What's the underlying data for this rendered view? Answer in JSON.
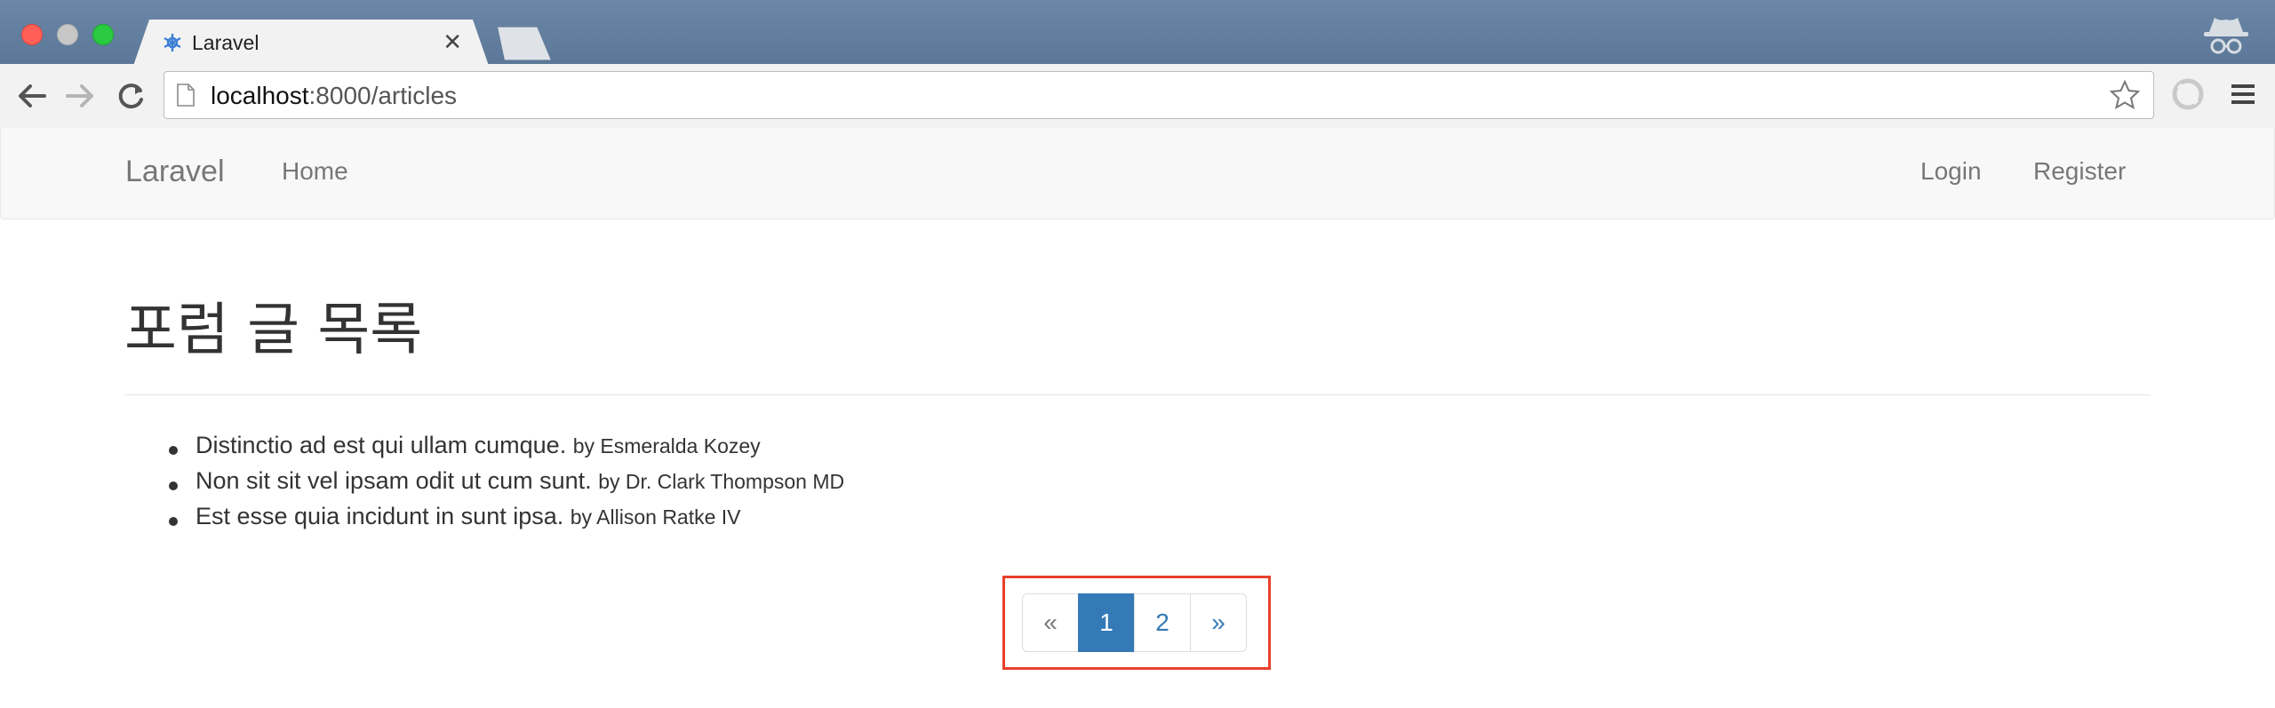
{
  "browser": {
    "tab_title": "Laravel",
    "close_glyph": "✕",
    "url_host": "localhost",
    "url_rest": ":8000/articles"
  },
  "navbar": {
    "brand": "Laravel",
    "home": "Home",
    "login": "Login",
    "register": "Register"
  },
  "page": {
    "heading": "포럼 글 목록",
    "articles": [
      {
        "title": "Distinctio ad est qui ullam cumque.",
        "author": "by Esmeralda Kozey"
      },
      {
        "title": "Non sit sit vel ipsam odit ut cum sunt.",
        "author": "by Dr. Clark Thompson MD"
      },
      {
        "title": "Est esse quia incidunt in sunt ipsa.",
        "author": "by Allison Ratke IV"
      }
    ]
  },
  "pagination": {
    "prev": "«",
    "pages": [
      "1",
      "2"
    ],
    "current": "1",
    "next": "»"
  },
  "colors": {
    "accent": "#337ab7",
    "highlight": "#e8402c",
    "titlebar": "#5b7898"
  },
  "icons": [
    "laravel-favicon-icon",
    "close-icon",
    "back-arrow-icon",
    "forward-arrow-icon",
    "reload-icon",
    "page-icon",
    "star-icon",
    "incognito-icon",
    "extension-icon",
    "menu-icon"
  ]
}
